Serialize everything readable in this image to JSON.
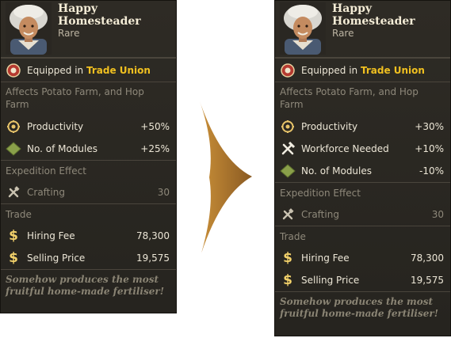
{
  "colors": {
    "accent": "#f0c020",
    "panel_bg": "#2a2722",
    "arrow": "#b8822e"
  },
  "left_card": {
    "name": "Happy Homesteader",
    "rarity": "Rare",
    "equipped_prefix": "Equipped in",
    "equipped_location": "Trade Union",
    "affects": "Affects Potato Farm, and Hop Farm",
    "effects": [
      {
        "icon": "productivity-gear-icon",
        "label": "Productivity",
        "value": "+50%"
      },
      {
        "icon": "module-diamond-icon",
        "label": "No. of Modules",
        "value": "+25%"
      }
    ],
    "expedition_header": "Expedition Effect",
    "expedition": {
      "icon": "crafting-tools-icon",
      "label": "Crafting",
      "value": "30"
    },
    "trade_header": "Trade",
    "trade": [
      {
        "icon": "dollar-icon",
        "label": "Hiring Fee",
        "value": "78,300"
      },
      {
        "icon": "dollar-icon",
        "label": "Selling Price",
        "value": "19,575"
      }
    ],
    "lore": "Somehow produces the most fruitful home-made fertiliser!"
  },
  "right_card": {
    "name": "Happy Homesteader",
    "rarity": "Rare",
    "equipped_prefix": "Equipped in",
    "equipped_location": "Trade Union",
    "affects": "Affects Potato Farm, and Hop Farm",
    "effects": [
      {
        "icon": "productivity-gear-icon",
        "label": "Productivity",
        "value": "+30%"
      },
      {
        "icon": "workforce-tools-icon",
        "label": "Workforce Needed",
        "value": "+10%"
      },
      {
        "icon": "module-diamond-icon",
        "label": "No. of Modules",
        "value": "-10%"
      }
    ],
    "expedition_header": "Expedition Effect",
    "expedition": {
      "icon": "crafting-tools-icon",
      "label": "Crafting",
      "value": "30"
    },
    "trade_header": "Trade",
    "trade": [
      {
        "icon": "dollar-icon",
        "label": "Hiring Fee",
        "value": "78,300"
      },
      {
        "icon": "dollar-icon",
        "label": "Selling Price",
        "value": "19,575"
      }
    ],
    "lore": "Somehow produces the most fruitful home-made fertiliser!"
  }
}
